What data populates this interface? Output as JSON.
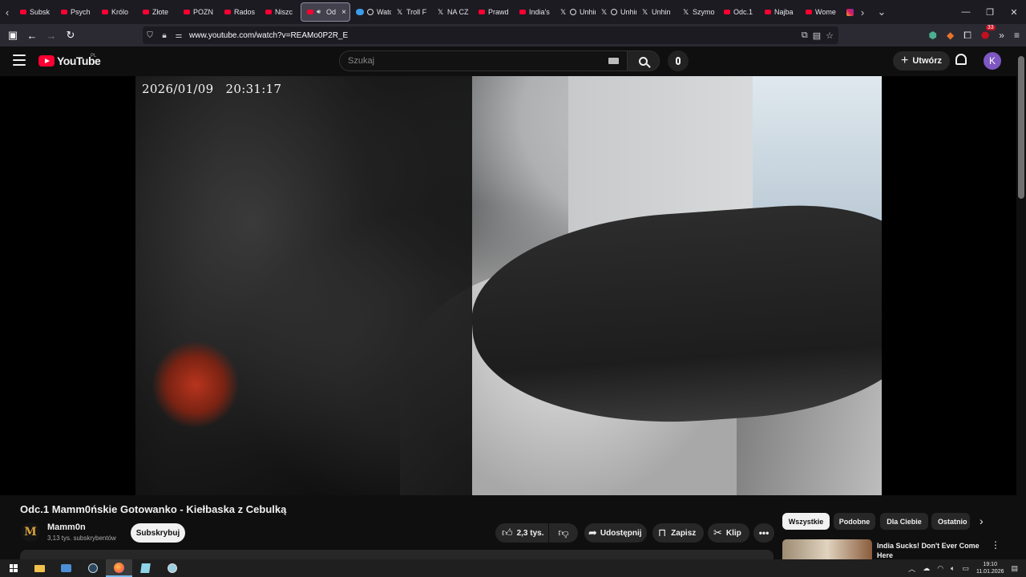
{
  "browser": {
    "tabs": [
      {
        "label": "Subsk",
        "icon": "youtube-icon"
      },
      {
        "label": "Psych",
        "icon": "youtube-icon"
      },
      {
        "label": "Królo",
        "icon": "youtube-icon"
      },
      {
        "label": "Złote",
        "icon": "youtube-icon"
      },
      {
        "label": "POZN",
        "icon": "youtube-icon"
      },
      {
        "label": "Rados",
        "icon": "youtube-icon"
      },
      {
        "label": "Niszc",
        "icon": "youtube-icon"
      },
      {
        "label": "Od",
        "icon": "youtube-icon",
        "active": true,
        "close": "×"
      },
      {
        "label": "Watch",
        "icon": "watch-icon"
      },
      {
        "label": "Troll F",
        "icon": "x-icon"
      },
      {
        "label": "NA CZ",
        "icon": "x-icon"
      },
      {
        "label": "Prawd",
        "icon": "youtube-icon"
      },
      {
        "label": "India's",
        "icon": "youtube-icon"
      },
      {
        "label": "Unhin",
        "icon": "x-icon"
      },
      {
        "label": "Unhin",
        "icon": "x-icon"
      },
      {
        "label": "Unhin",
        "icon": "x-icon"
      },
      {
        "label": "Szymo",
        "icon": "x-icon"
      },
      {
        "label": "Odc.1",
        "icon": "youtube-icon"
      },
      {
        "label": "Najba",
        "icon": "youtube-icon"
      },
      {
        "label": "Wome",
        "icon": "youtube-icon"
      }
    ],
    "url": "www.youtube.com/watch?v=REAMo0P2R_E",
    "extension_badge": "33"
  },
  "youtube": {
    "logo_text": "YouTube",
    "region": "PL",
    "search_placeholder": "Szukaj",
    "create_label": "Utwórz",
    "avatar_letter": "K"
  },
  "player": {
    "osd_date": "2026/01/09",
    "osd_time": "20:31:17"
  },
  "video": {
    "title": "Odc.1 Mamm0ńskie Gotowanko - Kiełbaska z Cebulką",
    "channel_name": "Mamm0n",
    "channel_avatar_letter": "M",
    "subscribers": "3,13 tys. subskrybentów",
    "subscribe_label": "Subskrybuj",
    "likes": "2,3 tys.",
    "share_label": "Udostępnij",
    "save_label": "Zapisz",
    "clip_label": "Klip"
  },
  "sidebar": {
    "chips": [
      "Wszystkie",
      "Podobne",
      "Dla Ciebie",
      "Ostatnio"
    ],
    "recommendation_title": "India Sucks! Don't Ever Come Here"
  },
  "taskbar": {
    "time": "19:10",
    "date": "11.01.2026"
  },
  "colors": {
    "youtube_red": "#ff0033",
    "page_bg": "#0f0f0f",
    "avatar_purple": "#7e57c2"
  }
}
